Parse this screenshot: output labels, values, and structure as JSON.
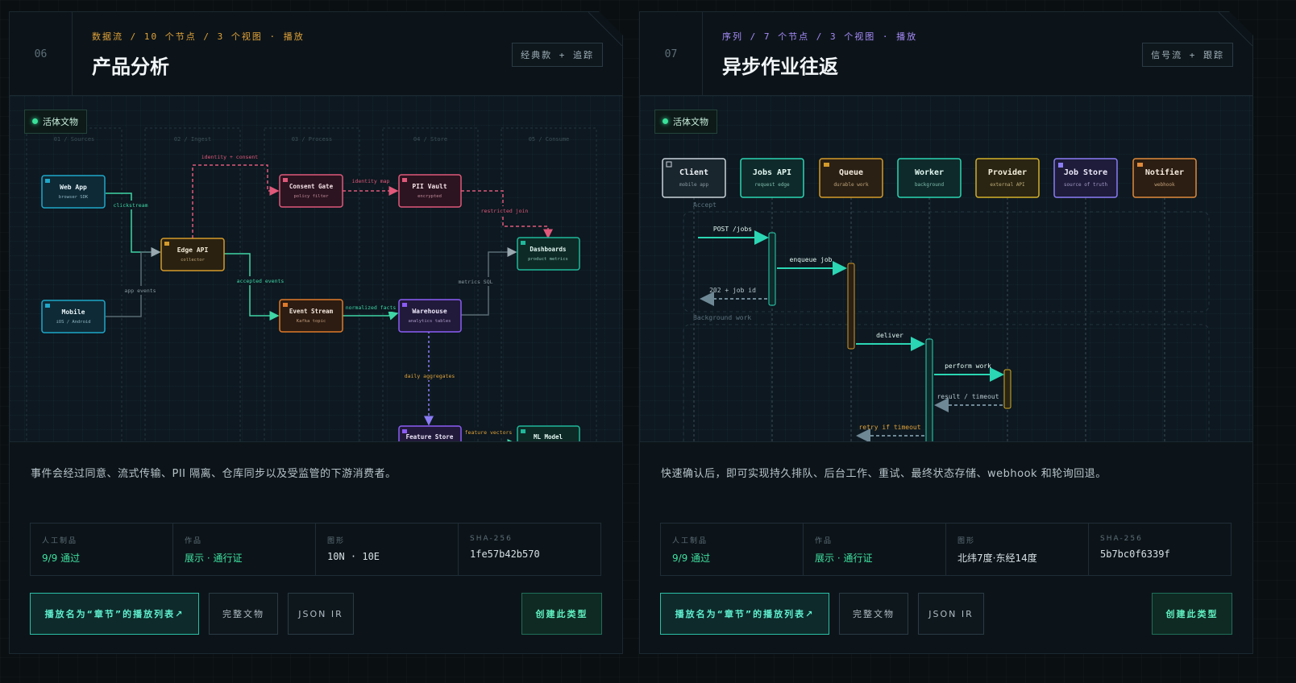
{
  "cards": [
    {
      "number": "06",
      "meta": "数据流 / 10 个节点 / 3 个视图 · 播放",
      "meta_color": "#e0a23a",
      "title": "产品分析",
      "tag": "经典款 + 追踪",
      "live_label": "活体文物",
      "description": "事件会经过同意、流式传输、PII 隔离、仓库同步以及受监管的下游消费者。",
      "stats": [
        {
          "label": "人工制品",
          "value": "9/9 通过"
        },
        {
          "label": "作品",
          "value": "展示 · 通行证"
        },
        {
          "label": "图形",
          "value": "10N · 10E"
        },
        {
          "label": "SHA-256",
          "value": "1fe57b42b570"
        }
      ],
      "buttons": {
        "playlist": "播放名为“章节”的播放列表↗",
        "full": "完整文物",
        "json": "JSON IR",
        "create": "创建此类型"
      },
      "diagram": {
        "lanes": [
          "01 / Sources",
          "02 / Ingest",
          "03 / Process",
          "04 / Store",
          "05 / Consume"
        ],
        "nodes": [
          {
            "id": "webapp",
            "label": "Web App",
            "sub": "browser SDK",
            "color": "#1fa7c9"
          },
          {
            "id": "mobile",
            "label": "Mobile",
            "sub": "iOS / Android",
            "color": "#1fa7c9"
          },
          {
            "id": "edge",
            "label": "Edge API",
            "sub": "collector",
            "color": "#d49a2a"
          },
          {
            "id": "consent",
            "label": "Consent Gate",
            "sub": "policy filter",
            "color": "#e0587a"
          },
          {
            "id": "stream",
            "label": "Event Stream",
            "sub": "Kafka topic",
            "color": "#e07a2a"
          },
          {
            "id": "vault",
            "label": "PII Vault",
            "sub": "encrypted",
            "color": "#e0587a"
          },
          {
            "id": "warehouse",
            "label": "Warehouse",
            "sub": "analytics tables",
            "color": "#8b5cf6"
          },
          {
            "id": "dashboards",
            "label": "Dashboards",
            "sub": "product metrics",
            "color": "#1fb89a"
          },
          {
            "id": "feature",
            "label": "Feature Store",
            "sub": "",
            "color": "#8b5cf6"
          },
          {
            "id": "ml",
            "label": "ML Model",
            "sub": "",
            "color": "#1fb89a"
          }
        ],
        "edge_labels": [
          "clickstream",
          "app events",
          "identity + consent",
          "identity map",
          "restricted join",
          "accepted events",
          "normalized facts",
          "metrics SQL",
          "daily aggregates",
          "feature vectors"
        ]
      }
    },
    {
      "number": "07",
      "meta": "序列 / 7 个节点 / 3 个视图 · 播放",
      "meta_color": "#a78bfa",
      "title": "异步作业往返",
      "tag": "信号流 + 跟踪",
      "live_label": "活体文物",
      "description": "快速确认后，即可实现持久排队、后台工作、重试、最终状态存储、webhook 和轮询回退。",
      "stats": [
        {
          "label": "人工制品",
          "value": "9/9 通过"
        },
        {
          "label": "作品",
          "value": "展示 · 通行证"
        },
        {
          "label": "图形",
          "value": "北纬7度·东经14度"
        },
        {
          "label": "SHA-256",
          "value": "5b7bc0f6339f"
        }
      ],
      "buttons": {
        "playlist": "播放名为“章节”的播放列表↗",
        "full": "完整文物",
        "json": "JSON IR",
        "create": "创建此类型"
      },
      "diagram": {
        "actors": [
          {
            "label": "Client",
            "sub": "mobile app",
            "color": "#c9d3da"
          },
          {
            "label": "Jobs API",
            "sub": "request edge",
            "color": "#2bd6b4"
          },
          {
            "label": "Queue",
            "sub": "durable work",
            "color": "#d49a2a"
          },
          {
            "label": "Worker",
            "sub": "background",
            "color": "#2bd6b4"
          },
          {
            "label": "Provider",
            "sub": "external API",
            "color": "#d4b02a"
          },
          {
            "label": "Job Store",
            "sub": "source of truth",
            "color": "#8b7cf6"
          },
          {
            "label": "Notifier",
            "sub": "webhook",
            "color": "#e08a3a"
          }
        ],
        "groups": [
          "Accept",
          "Background work"
        ],
        "messages": [
          "POST /jobs",
          "enqueue job",
          "202 + job id",
          "deliver",
          "perform work",
          "result / timeout",
          "retry if timeout"
        ]
      }
    }
  ]
}
